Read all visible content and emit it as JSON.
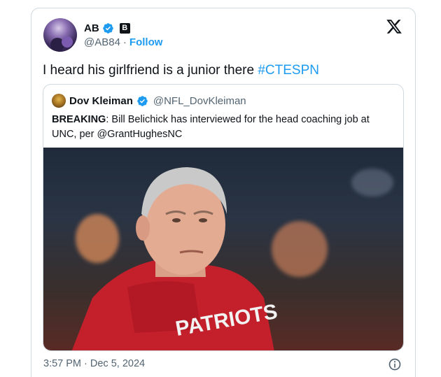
{
  "tweet": {
    "author_name": "AB",
    "author_handle": "@AB84",
    "separator": "·",
    "follow_label": "Follow",
    "text": "I heard his girlfriend is a junior there ",
    "hashtag": "#CTESPN",
    "timestamp": "3:57 PM · Dec 5, 2024",
    "affiliate_badge": "B"
  },
  "quote": {
    "author_name": "Dov Kleiman",
    "author_handle": "@NFL_DovKleiman",
    "text_bold": "BREAKING",
    "text": ": Bill Belichick has interviewed for the head coaching job at UNC, per @GrantHughesNC"
  },
  "photo": {
    "sweatshirt_text": "PATRIOTS"
  },
  "colors": {
    "accent": "#1d9bf0",
    "text": "#0f1419",
    "muted": "#536471",
    "border": "#cfd9de",
    "sweatshirt_red": "#c4202c"
  },
  "icons": {
    "verified": "verified-badge-icon",
    "platform": "x-logo-icon",
    "info": "info-icon"
  }
}
